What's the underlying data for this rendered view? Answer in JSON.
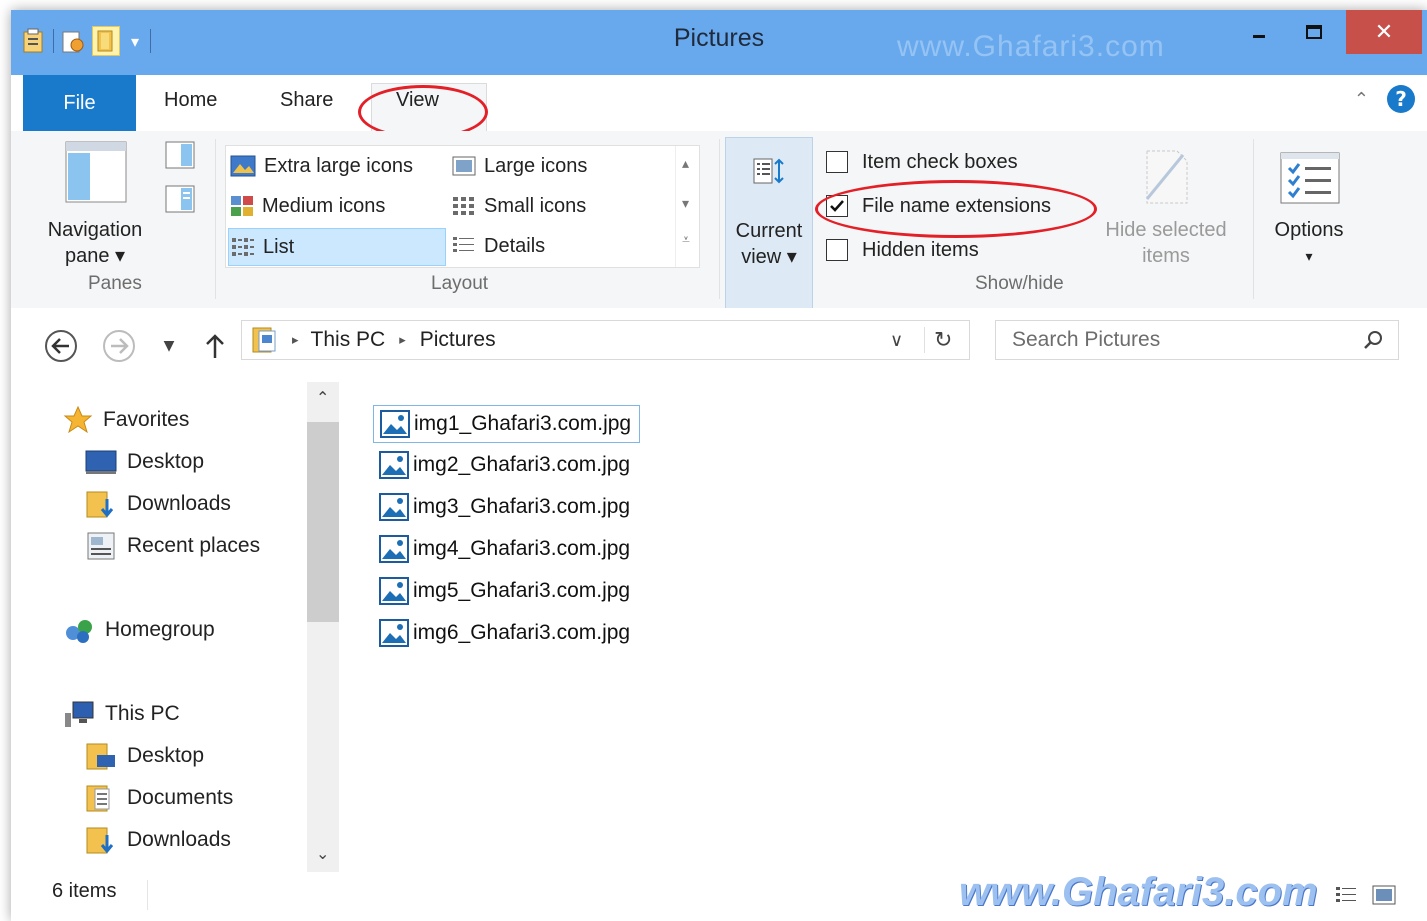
{
  "window": {
    "title": "Pictures",
    "watermark": "www.Ghafari3.com"
  },
  "tabs": {
    "file": "File",
    "home": "Home",
    "share": "Share",
    "view": "View"
  },
  "ribbon": {
    "panes": {
      "nav_line1": "Navigation",
      "nav_line2": "pane ▾",
      "group": "Panes"
    },
    "layout": {
      "group": "Layout",
      "items": [
        "Extra large icons",
        "Large icons",
        "Medium icons",
        "Small icons",
        "List",
        "Details"
      ]
    },
    "current_view": {
      "line1": "Current",
      "line2": "view ▾"
    },
    "showhide": {
      "group": "Show/hide",
      "item_check_boxes": "Item check boxes",
      "file_name_extensions": "File name extensions",
      "hidden_items": "Hidden items",
      "hide_selected_line1": "Hide selected",
      "hide_selected_line2": "items"
    },
    "options": {
      "label": "Options",
      "arrow": "▾"
    }
  },
  "address": {
    "root": "This PC",
    "current": "Pictures",
    "search_placeholder": "Search Pictures"
  },
  "nav": {
    "favorites": "Favorites",
    "fav_items": [
      "Desktop",
      "Downloads",
      "Recent places"
    ],
    "homegroup": "Homegroup",
    "thispc": "This PC",
    "pc_items": [
      "Desktop",
      "Documents",
      "Downloads"
    ]
  },
  "files": [
    "img1_Ghafari3.com.jpg",
    "img2_Ghafari3.com.jpg",
    "img3_Ghafari3.com.jpg",
    "img4_Ghafari3.com.jpg",
    "img5_Ghafari3.com.jpg",
    "img6_Ghafari3.com.jpg"
  ],
  "status": {
    "count": "6 items",
    "watermark": "www.Ghafari3.com"
  },
  "colors": {
    "titlebar": "#68a9ee",
    "file_tab": "#1979ca",
    "close": "#c7504b",
    "annotation": "#e32027"
  }
}
